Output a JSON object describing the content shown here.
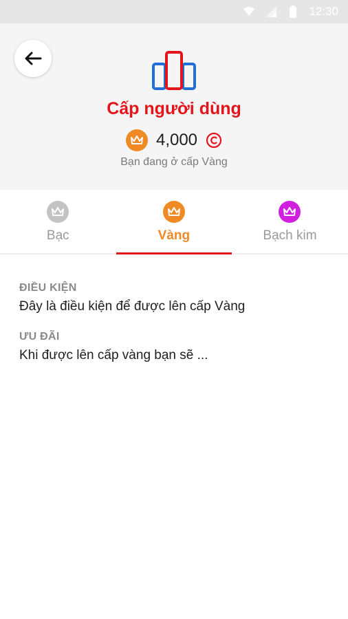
{
  "status_bar": {
    "time": "12:30"
  },
  "header": {
    "title": "Cấp người dùng",
    "points": "4,000",
    "subtitle": "Bạn đang ở cấp Vàng"
  },
  "tabs": [
    {
      "label": "Bạc",
      "color": "#c3c3c3"
    },
    {
      "label": "Vàng",
      "color": "#f08a24"
    },
    {
      "label": "Bạch kim",
      "color": "#d11fe0"
    }
  ],
  "active_tab": "Vàng",
  "content": {
    "condition_heading": "ĐIỀU KIỆN",
    "condition_text": "Đây là điều kiện để được lên cấp Vàng",
    "benefit_heading": "ƯU ĐÃI",
    "benefit_text": "Khi được lên cấp vàng bạn sẽ ..."
  },
  "colors": {
    "accent": "#e3151a",
    "gold": "#f08a24",
    "platinum": "#d11fe0",
    "silver": "#c3c3c3",
    "building_blue": "#1f6fd6"
  }
}
